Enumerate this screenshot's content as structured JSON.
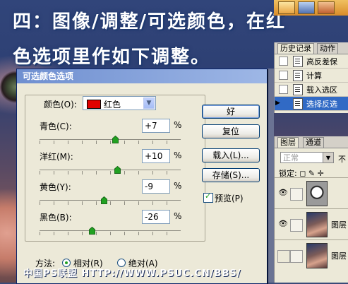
{
  "caption": {
    "line1": "四：图像/调整/可选颜色，在红",
    "line2": "色选项里作如下调整。"
  },
  "watermark": "中国PS联盟 HTTP://WWW.PSUC.CN/BBS/",
  "history_panel": {
    "tabs": [
      "历史记录",
      "动作"
    ],
    "items": [
      {
        "label": "高反差保",
        "selected": false
      },
      {
        "label": "计算",
        "selected": false
      },
      {
        "label": "载入选区",
        "selected": false
      },
      {
        "label": "选择反选",
        "selected": true
      }
    ]
  },
  "layers_panel": {
    "tabs": [
      "图层",
      "通道"
    ],
    "blend_mode": "正常",
    "opacity_label": "不",
    "lock_label": "锁定:",
    "layers": [
      {
        "name": "",
        "visible": true,
        "thumb": "adjustment"
      },
      {
        "name": "图层",
        "visible": true,
        "thumb": "photo"
      },
      {
        "name": "图层",
        "visible": false,
        "thumb": "photo"
      }
    ]
  },
  "dialog": {
    "title": "可选颜色选项",
    "colors_label": "颜色(O):",
    "color_value": "红色",
    "swatch_color": "#e00000",
    "sliders": [
      {
        "label": "青色(C):",
        "value": "+7",
        "unit": "%",
        "percent": 7
      },
      {
        "label": "洋红(M):",
        "value": "+10",
        "unit": "%",
        "percent": 10
      },
      {
        "label": "黄色(Y):",
        "value": "-9",
        "unit": "%",
        "percent": -9
      },
      {
        "label": "黑色(B):",
        "value": "-26",
        "unit": "%",
        "percent": -26
      }
    ],
    "buttons": {
      "ok": "好",
      "reset": "复位",
      "load": "载入(L)...",
      "save": "存储(S)..."
    },
    "preview_label": "预览(P)",
    "preview_checked": true,
    "method_label": "方法:",
    "method_relative": "相对(R)",
    "method_absolute": "绝对(A)",
    "method_selected": "relative"
  }
}
